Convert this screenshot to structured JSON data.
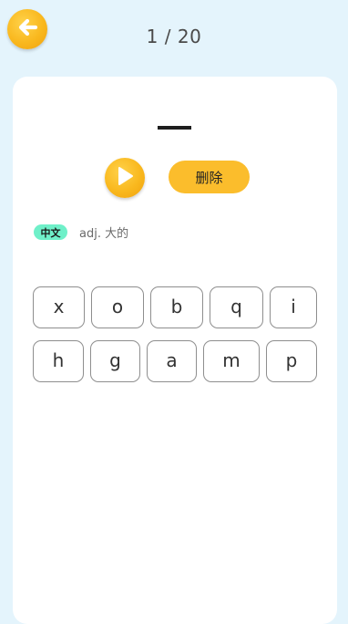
{
  "header": {
    "back_icon": "arrow-left-icon",
    "counter": "1 / 20"
  },
  "word": {
    "blank": "—"
  },
  "controls": {
    "play_icon": "play-icon",
    "delete_label": "删除"
  },
  "hint": {
    "lang_badge": "中文",
    "meaning": "adj. 大的"
  },
  "letters": {
    "row1": [
      "x",
      "o",
      "b",
      "q",
      "i"
    ],
    "row2": [
      "h",
      "g",
      "a",
      "m",
      "p"
    ]
  },
  "colors": {
    "background": "#e4f4fc",
    "accent": "#fbbd2c",
    "badge": "#6ff0c9"
  }
}
